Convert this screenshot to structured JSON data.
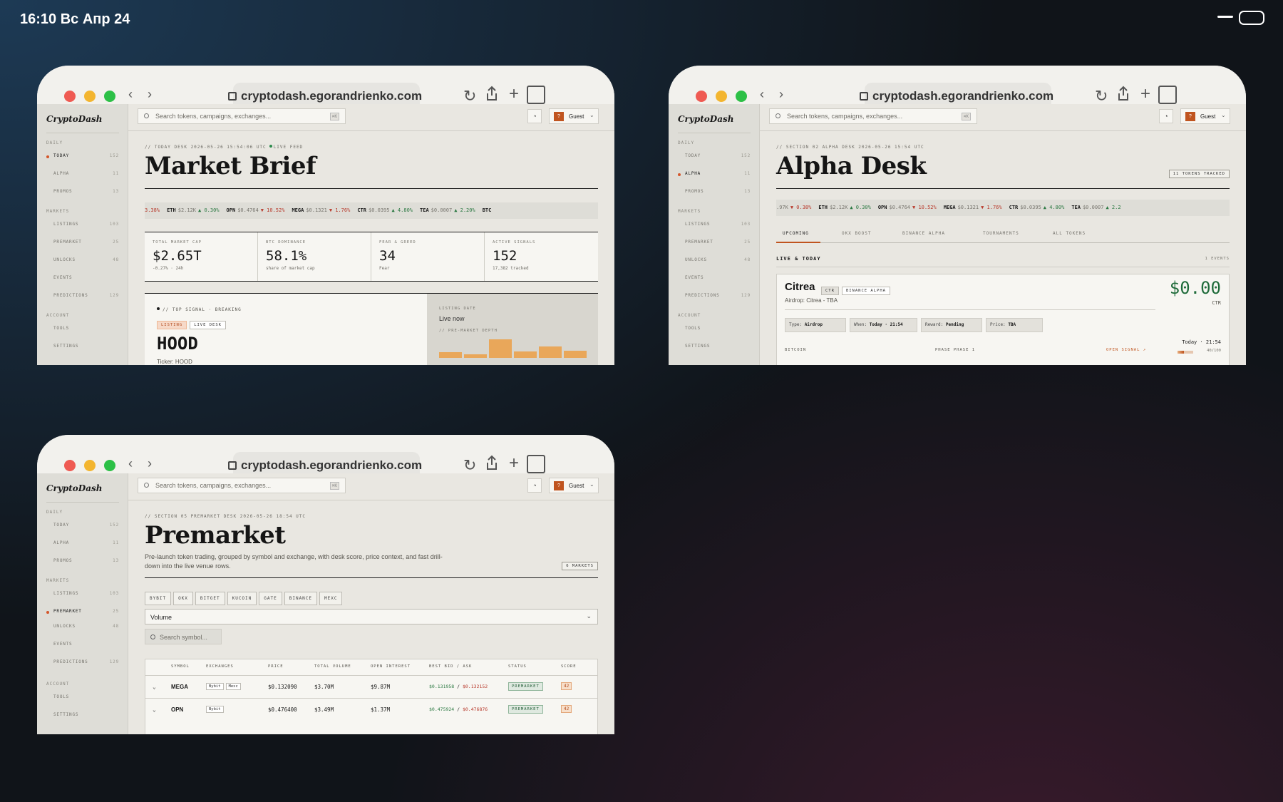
{
  "status": {
    "time": "16:10 Вс Апр 24"
  },
  "browser": {
    "url": "cryptodash.egorandrienko.com",
    "nav_arrows": "‹ ›",
    "reload": "↻",
    "plus": "+"
  },
  "app": {
    "logo": "CryptoDash",
    "search_placeholder": "Search tokens, campaigns, exchanges...",
    "search_kbd": "⌘K",
    "bell": "🔔",
    "user": {
      "avatar": "?",
      "name": "Guest",
      "chevron": "⌄"
    },
    "sidebar": {
      "daily_label": "DAILY",
      "markets_label": "MARKETS",
      "account_label": "ACCOUNT",
      "daily": [
        {
          "label": "TODAY",
          "count": "152"
        },
        {
          "label": "ALPHA",
          "count": "11"
        },
        {
          "label": "PROMOS",
          "count": "13"
        }
      ],
      "markets": [
        {
          "label": "LISTINGS",
          "count": "103"
        },
        {
          "label": "PREMARKET",
          "count": "25"
        },
        {
          "label": "UNLOCKS",
          "count": "48"
        },
        {
          "label": "EVENTS",
          "count": ""
        },
        {
          "label": "PREDICTIONS",
          "count": "129"
        }
      ],
      "account": [
        {
          "label": "TOOLS"
        },
        {
          "label": "SETTINGS"
        }
      ]
    }
  },
  "market_brief": {
    "kicker": "// TODAY DESK 2026-05-26 15:54:06 UTC",
    "live": "LIVE FEED",
    "title": "Market Brief",
    "ticker": [
      {
        "sym": "",
        "px": "",
        "chg": "3.38%",
        "dir": "dn"
      },
      {
        "sym": "ETH",
        "px": "$2.12K",
        "chg": "▲ 0.30%",
        "dir": "up"
      },
      {
        "sym": "OPN",
        "px": "$0.4764",
        "chg": "▼ 10.52%",
        "dir": "dn"
      },
      {
        "sym": "MEGA",
        "px": "$0.1321",
        "chg": "▼ 1.76%",
        "dir": "dn"
      },
      {
        "sym": "CTR",
        "px": "$0.0395",
        "chg": "▲ 4.80%",
        "dir": "up"
      },
      {
        "sym": "TEA",
        "px": "$0.0007",
        "chg": "▲ 2.20%",
        "dir": "up"
      },
      {
        "sym": "BTC",
        "px": "",
        "chg": "",
        "dir": "up"
      }
    ],
    "stats": [
      {
        "label": "TOTAL MARKET CAP",
        "value": "$2.65T",
        "sub": "-0.27% · 24h"
      },
      {
        "label": "BTC DOMINANCE",
        "value": "58.1%",
        "sub": "share of market cap"
      },
      {
        "label": "FEAR & GREED",
        "value": "34",
        "sub": "Fear"
      },
      {
        "label": "ACTIVE SIGNALS",
        "value": "152",
        "sub": "17,382 tracked"
      }
    ],
    "signal": {
      "kicker": "// TOP SIGNAL · BREAKING",
      "tag1": "LISTING",
      "tag2": "LIVE DESK",
      "symbol": "HOOD",
      "sub": "Ticker: HOOD",
      "listing_label": "LISTING DATE",
      "listing_value": "Live now",
      "depth_label": "// PRE-MARKET DEPTH",
      "depth": [
        0.3,
        0.2,
        1.0,
        0.35,
        0.6,
        0.4
      ]
    }
  },
  "alpha_desk": {
    "kicker": "// SECTION 02 ALPHA DESK 2026-05-26 15:54 UTC",
    "title": "Alpha Desk",
    "tracked": "11 TOKENS TRACKED",
    "ticker": [
      {
        "sym": "",
        "px": ".97K",
        "chg": "▼ 0.38%",
        "dir": "dn"
      },
      {
        "sym": "ETH",
        "px": "$2.12K",
        "chg": "▲ 0.30%",
        "dir": "up"
      },
      {
        "sym": "OPN",
        "px": "$0.4764",
        "chg": "▼ 10.52%",
        "dir": "dn"
      },
      {
        "sym": "MEGA",
        "px": "$0.1321",
        "chg": "▼ 1.76%",
        "dir": "dn"
      },
      {
        "sym": "CTR",
        "px": "$0.0395",
        "chg": "▲ 4.80%",
        "dir": "up"
      },
      {
        "sym": "TEA",
        "px": "$0.0007",
        "chg": "▲ 2.2",
        "dir": "up"
      }
    ],
    "tabs": [
      "UPCOMING",
      "OKX BOOST",
      "BINANCE ALPHA",
      "TOURNAMENTS",
      "ALL TOKENS"
    ],
    "section": "LIVE & TODAY",
    "section_count": "1 EVENTS",
    "card": {
      "title": "Citrea",
      "tag_ticker": "CTR",
      "tag_venue": "BINANCE ALPHA",
      "sub": "Airdrop: Citrea - TBA",
      "price": "$0.00",
      "currency": "CTR",
      "chips": [
        {
          "k": "Type:",
          "v": "Airdrop"
        },
        {
          "k": "When:",
          "v": "Today · 21:54"
        },
        {
          "k": "Reward:",
          "v": "Pending"
        },
        {
          "k": "Price:",
          "v": "TBA"
        }
      ],
      "when": "Today · 21:54",
      "chain": "BITCOIN",
      "phase": "PHASE PHASE 1",
      "open": "OPEN SIGNAL ↗",
      "progress_label": "40/100",
      "progress": 0.4
    }
  },
  "premarket": {
    "kicker": "// SECTION 05 PREMARKET DESK 2026-05-26 18:54 UTC",
    "title": "Premarket",
    "intro": "Pre-launch token trading, grouped by symbol and exchange, with desk score, price context, and fast drill-down into the live venue rows.",
    "markets": "6 MARKETS",
    "exchanges": [
      "BYBIT",
      "OKX",
      "BITGET",
      "KUCOIN",
      "GATE",
      "BINANCE",
      "MEXC"
    ],
    "sort": "Volume",
    "search_placeholder": "Search symbol...",
    "columns": [
      "SYMBOL",
      "EXCHANGES",
      "PRICE",
      "TOTAL VOLUME",
      "OPEN INTEREST",
      "BEST BID / ASK",
      "STATUS",
      "SCORE"
    ],
    "rows": [
      {
        "symbol": "MEGA",
        "ex": [
          "Bybit",
          "Mexc"
        ],
        "price": "$0.132090",
        "vol": "$3.70M",
        "oi": "$9.87M",
        "bid": "$0.131958",
        "ask": "$0.132152",
        "status": "PREMARKET",
        "score": "42"
      },
      {
        "symbol": "OPN",
        "ex": [
          "Bybit"
        ],
        "price": "$0.476400",
        "vol": "$3.49M",
        "oi": "$1.37M",
        "bid": "$0.475924",
        "ask": "$0.476876",
        "status": "PREMARKET",
        "score": "42"
      }
    ]
  }
}
